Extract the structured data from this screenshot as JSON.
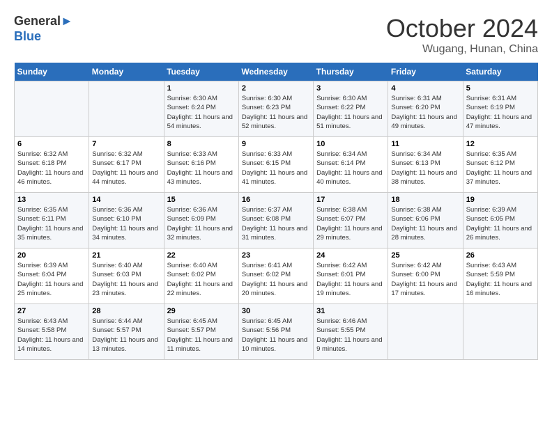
{
  "header": {
    "logo_line1": "General",
    "logo_line2": "Blue",
    "month": "October 2024",
    "location": "Wugang, Hunan, China"
  },
  "days_of_week": [
    "Sunday",
    "Monday",
    "Tuesday",
    "Wednesday",
    "Thursday",
    "Friday",
    "Saturday"
  ],
  "weeks": [
    [
      {
        "day": "",
        "info": ""
      },
      {
        "day": "",
        "info": ""
      },
      {
        "day": "1",
        "info": "Sunrise: 6:30 AM\nSunset: 6:24 PM\nDaylight: 11 hours and 54 minutes."
      },
      {
        "day": "2",
        "info": "Sunrise: 6:30 AM\nSunset: 6:23 PM\nDaylight: 11 hours and 52 minutes."
      },
      {
        "day": "3",
        "info": "Sunrise: 6:30 AM\nSunset: 6:22 PM\nDaylight: 11 hours and 51 minutes."
      },
      {
        "day": "4",
        "info": "Sunrise: 6:31 AM\nSunset: 6:20 PM\nDaylight: 11 hours and 49 minutes."
      },
      {
        "day": "5",
        "info": "Sunrise: 6:31 AM\nSunset: 6:19 PM\nDaylight: 11 hours and 47 minutes."
      }
    ],
    [
      {
        "day": "6",
        "info": "Sunrise: 6:32 AM\nSunset: 6:18 PM\nDaylight: 11 hours and 46 minutes."
      },
      {
        "day": "7",
        "info": "Sunrise: 6:32 AM\nSunset: 6:17 PM\nDaylight: 11 hours and 44 minutes."
      },
      {
        "day": "8",
        "info": "Sunrise: 6:33 AM\nSunset: 6:16 PM\nDaylight: 11 hours and 43 minutes."
      },
      {
        "day": "9",
        "info": "Sunrise: 6:33 AM\nSunset: 6:15 PM\nDaylight: 11 hours and 41 minutes."
      },
      {
        "day": "10",
        "info": "Sunrise: 6:34 AM\nSunset: 6:14 PM\nDaylight: 11 hours and 40 minutes."
      },
      {
        "day": "11",
        "info": "Sunrise: 6:34 AM\nSunset: 6:13 PM\nDaylight: 11 hours and 38 minutes."
      },
      {
        "day": "12",
        "info": "Sunrise: 6:35 AM\nSunset: 6:12 PM\nDaylight: 11 hours and 37 minutes."
      }
    ],
    [
      {
        "day": "13",
        "info": "Sunrise: 6:35 AM\nSunset: 6:11 PM\nDaylight: 11 hours and 35 minutes."
      },
      {
        "day": "14",
        "info": "Sunrise: 6:36 AM\nSunset: 6:10 PM\nDaylight: 11 hours and 34 minutes."
      },
      {
        "day": "15",
        "info": "Sunrise: 6:36 AM\nSunset: 6:09 PM\nDaylight: 11 hours and 32 minutes."
      },
      {
        "day": "16",
        "info": "Sunrise: 6:37 AM\nSunset: 6:08 PM\nDaylight: 11 hours and 31 minutes."
      },
      {
        "day": "17",
        "info": "Sunrise: 6:38 AM\nSunset: 6:07 PM\nDaylight: 11 hours and 29 minutes."
      },
      {
        "day": "18",
        "info": "Sunrise: 6:38 AM\nSunset: 6:06 PM\nDaylight: 11 hours and 28 minutes."
      },
      {
        "day": "19",
        "info": "Sunrise: 6:39 AM\nSunset: 6:05 PM\nDaylight: 11 hours and 26 minutes."
      }
    ],
    [
      {
        "day": "20",
        "info": "Sunrise: 6:39 AM\nSunset: 6:04 PM\nDaylight: 11 hours and 25 minutes."
      },
      {
        "day": "21",
        "info": "Sunrise: 6:40 AM\nSunset: 6:03 PM\nDaylight: 11 hours and 23 minutes."
      },
      {
        "day": "22",
        "info": "Sunrise: 6:40 AM\nSunset: 6:02 PM\nDaylight: 11 hours and 22 minutes."
      },
      {
        "day": "23",
        "info": "Sunrise: 6:41 AM\nSunset: 6:02 PM\nDaylight: 11 hours and 20 minutes."
      },
      {
        "day": "24",
        "info": "Sunrise: 6:42 AM\nSunset: 6:01 PM\nDaylight: 11 hours and 19 minutes."
      },
      {
        "day": "25",
        "info": "Sunrise: 6:42 AM\nSunset: 6:00 PM\nDaylight: 11 hours and 17 minutes."
      },
      {
        "day": "26",
        "info": "Sunrise: 6:43 AM\nSunset: 5:59 PM\nDaylight: 11 hours and 16 minutes."
      }
    ],
    [
      {
        "day": "27",
        "info": "Sunrise: 6:43 AM\nSunset: 5:58 PM\nDaylight: 11 hours and 14 minutes."
      },
      {
        "day": "28",
        "info": "Sunrise: 6:44 AM\nSunset: 5:57 PM\nDaylight: 11 hours and 13 minutes."
      },
      {
        "day": "29",
        "info": "Sunrise: 6:45 AM\nSunset: 5:57 PM\nDaylight: 11 hours and 11 minutes."
      },
      {
        "day": "30",
        "info": "Sunrise: 6:45 AM\nSunset: 5:56 PM\nDaylight: 11 hours and 10 minutes."
      },
      {
        "day": "31",
        "info": "Sunrise: 6:46 AM\nSunset: 5:55 PM\nDaylight: 11 hours and 9 minutes."
      },
      {
        "day": "",
        "info": ""
      },
      {
        "day": "",
        "info": ""
      }
    ]
  ]
}
